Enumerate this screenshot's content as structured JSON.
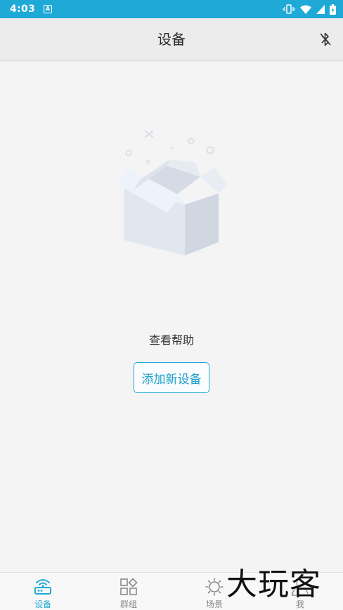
{
  "status_bar": {
    "time": "4:03",
    "notification_icon_letter": "A",
    "icons": [
      "vibrate-icon",
      "wifi-icon",
      "signal-icon",
      "battery-icon"
    ]
  },
  "app_bar": {
    "title": "设备",
    "right_icon": "bluetooth-icon"
  },
  "empty_state": {
    "illustration": "empty-box",
    "help_link": "查看帮助",
    "add_button": "添加新设备"
  },
  "bottom_nav": {
    "items": [
      {
        "label": "设备",
        "icon": "router-icon",
        "active": true
      },
      {
        "label": "群组",
        "icon": "grid-icon",
        "active": false
      },
      {
        "label": "场景",
        "icon": "sun-icon",
        "active": false
      },
      {
        "label": "我",
        "icon": "person-icon",
        "active": false
      }
    ]
  },
  "watermark": "大玩客",
  "colors": {
    "accent": "#1fa9d6",
    "background": "#f4f4f4",
    "app_bar": "#ececec"
  }
}
